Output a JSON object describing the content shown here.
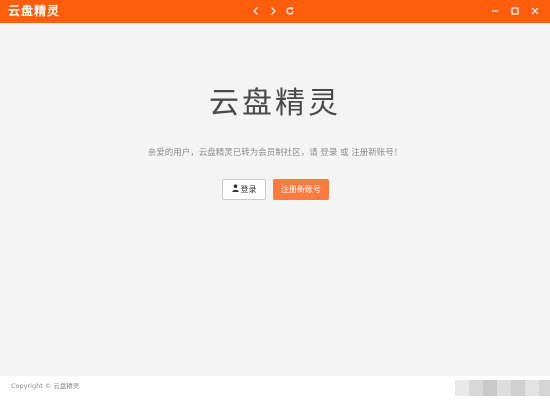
{
  "titlebar": {
    "app_name": "云盘精灵",
    "icons": [
      "chevron-left-icon",
      "chevron-right-icon",
      "refresh-icon",
      "minimize-icon",
      "maximize-icon",
      "close-icon"
    ],
    "color": "#ff5c0c"
  },
  "main": {
    "brand": "云盘精灵",
    "notice": "亲爱的用户，云盘精灵已转为会员制社区，请 登录 或 注册新账号！",
    "login_label": "登录",
    "register_label": "注册新账号",
    "accent_color": "#f97b42"
  },
  "footer": {
    "copyright": "Copyright © 云盘精灵"
  }
}
